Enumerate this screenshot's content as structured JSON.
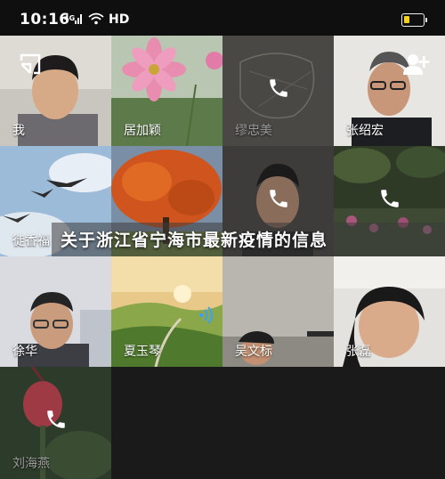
{
  "status_bar": {
    "time": "10:16",
    "network_label": "4G",
    "hd_label": "HD",
    "battery_level": 0.3,
    "battery_color": "#f5d21a"
  },
  "call": {
    "participants": [
      {
        "name": "我",
        "state": "video"
      },
      {
        "name": "居加颖",
        "state": "video"
      },
      {
        "name": "缪忠美",
        "state": "calling"
      },
      {
        "name": "张绍宏",
        "state": "video"
      },
      {
        "name": "徒香福",
        "state": "video"
      },
      {
        "name": "",
        "state": "video"
      },
      {
        "name": "",
        "state": "calling"
      },
      {
        "name": "",
        "state": "calling"
      },
      {
        "name": "徐华",
        "state": "video"
      },
      {
        "name": "夏玉琴",
        "state": "speaking"
      },
      {
        "name": "吴文标",
        "state": "video"
      },
      {
        "name": "张磊",
        "state": "video"
      },
      {
        "name": "刘海燕",
        "state": "calling"
      }
    ],
    "icons": {
      "minimize": "minimize-window-icon",
      "add_member": "add-user-icon",
      "calling": "phone-icon",
      "speaking": "sound-wave-icon"
    }
  },
  "overlay": {
    "headline": "关于浙江省宁海市最新疫情的信息"
  }
}
